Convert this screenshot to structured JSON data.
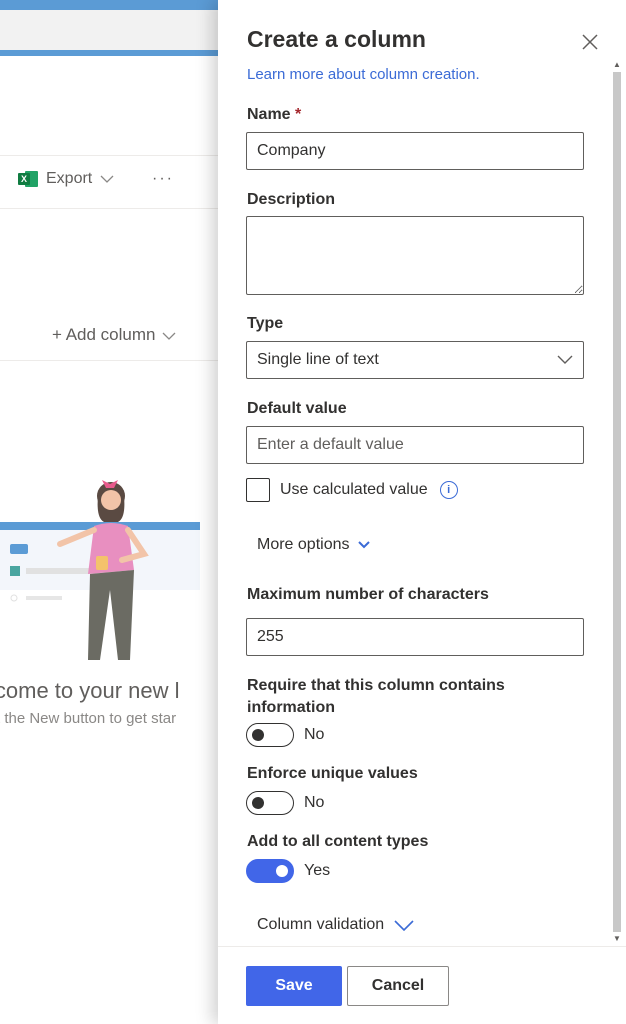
{
  "background": {
    "export_label": "Export",
    "more_label": "···",
    "add_column_label": "+ Add column",
    "welcome_text": "lcome to your new l",
    "hint_text": "t the New button to get star"
  },
  "panel": {
    "title": "Create a column",
    "learn_more": "Learn more about column creation.",
    "name_label": "Name",
    "required_mark": "*",
    "name_value": "Company",
    "description_label": "Description",
    "description_value": "",
    "type_label": "Type",
    "type_value": "Single line of text",
    "default_label": "Default value",
    "default_placeholder": "Enter a default value",
    "calculated_label": "Use calculated value",
    "more_options": "More options",
    "max_chars_label": "Maximum number of characters",
    "max_chars_value": "255",
    "require_label": "Require that this column contains information",
    "require_state": "No",
    "unique_label": "Enforce unique values",
    "unique_state": "No",
    "content_types_label": "Add to all content types",
    "content_types_state": "Yes",
    "column_validation": "Column validation"
  },
  "footer": {
    "save_label": "Save",
    "cancel_label": "Cancel"
  },
  "colors": {
    "accent": "#4166e8",
    "link": "#3b6bd6",
    "required": "#a4262c"
  }
}
